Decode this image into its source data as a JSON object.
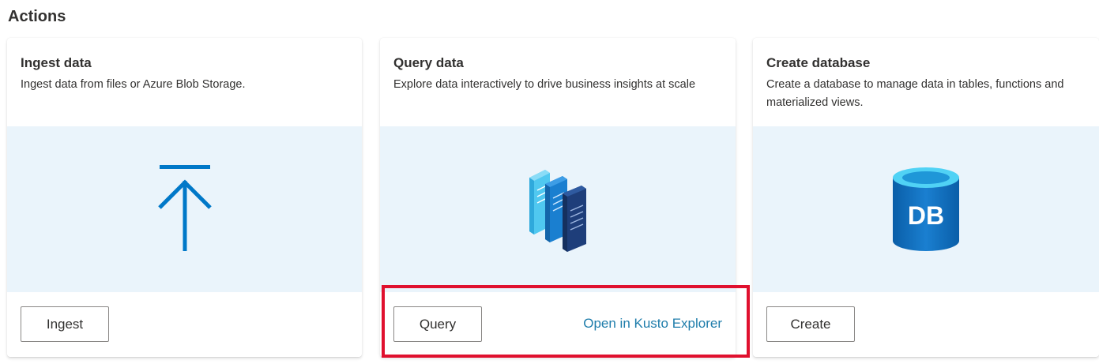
{
  "section": {
    "title": "Actions"
  },
  "cards": [
    {
      "title": "Ingest data",
      "description": "Ingest data from files or Azure Blob Storage.",
      "icon": "upload-arrow-icon",
      "button_label": "Ingest"
    },
    {
      "title": "Query data",
      "description": "Explore data interactively to drive business insights at scale",
      "icon": "query-documents-icon",
      "button_label": "Query",
      "link_label": "Open in Kusto Explorer"
    },
    {
      "title": "Create database",
      "description": "Create a database to manage data in tables, functions and materialized views.",
      "icon": "database-icon",
      "icon_text": "DB",
      "button_label": "Create"
    }
  ],
  "colors": {
    "image_panel_bg": "#eaf4fb",
    "accent_blue": "#0078c8",
    "link_color": "#1f7dab",
    "highlight_red": "#e0102e"
  }
}
